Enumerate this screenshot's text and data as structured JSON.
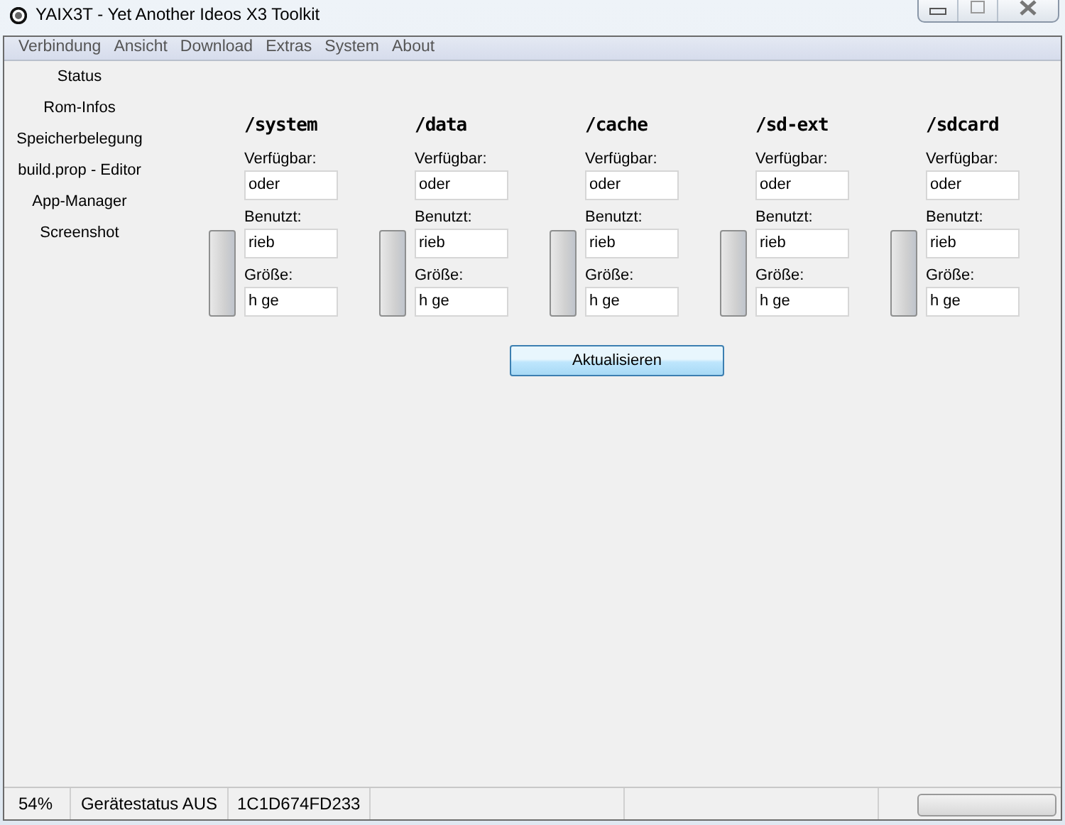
{
  "window": {
    "title": "YAIX3T - Yet Another Ideos X3 Toolkit"
  },
  "menu": [
    "Verbindung",
    "Ansicht",
    "Download",
    "Extras",
    "System",
    "About"
  ],
  "sidebar": {
    "items": [
      {
        "label": "Status"
      },
      {
        "label": "Rom-Infos"
      },
      {
        "label": "Speicherbelegung"
      },
      {
        "label": "build.prop - Editor"
      },
      {
        "label": "App-Manager"
      },
      {
        "label": "Screenshot"
      }
    ]
  },
  "volumes": [
    {
      "name": "/system",
      "available_label": "Verfügbar:",
      "available": "oder",
      "used_label": "Benutzt:",
      "used": "rieb",
      "size_label": "Größe:",
      "size": "h ge",
      "level": 0
    },
    {
      "name": "/data",
      "available_label": "Verfügbar:",
      "available": "oder",
      "used_label": "Benutzt:",
      "used": "rieb",
      "size_label": "Größe:",
      "size": "h ge",
      "level": 0
    },
    {
      "name": "/cache",
      "available_label": "Verfügbar:",
      "available": "oder",
      "used_label": "Benutzt:",
      "used": "rieb",
      "size_label": "Größe:",
      "size": "h ge",
      "level": 0
    },
    {
      "name": "/sd-ext",
      "available_label": "Verfügbar:",
      "available": "oder",
      "used_label": "Benutzt:",
      "used": "rieb",
      "size_label": "Größe:",
      "size": "h ge",
      "level": 0
    },
    {
      "name": "/sdcard",
      "available_label": "Verfügbar:",
      "available": "oder",
      "used_label": "Benutzt:",
      "used": "rieb",
      "size_label": "Größe:",
      "size": "h ge",
      "level": 0
    }
  ],
  "refresh_button": "Aktualisieren",
  "status_bar": {
    "percent": "54%",
    "device_status": "Gerätestatus AUS",
    "serial": "1C1D674FD233",
    "progress": {
      "level": 0
    }
  }
}
